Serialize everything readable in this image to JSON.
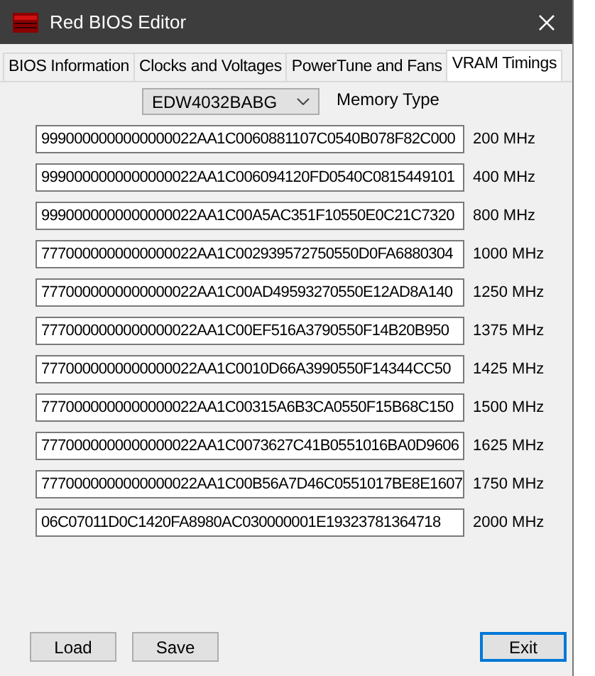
{
  "window": {
    "title": "Red BIOS Editor"
  },
  "tabs": [
    {
      "label": "BIOS Information",
      "selected": false
    },
    {
      "label": "Clocks and Voltages",
      "selected": false
    },
    {
      "label": "PowerTune and Fans",
      "selected": false
    },
    {
      "label": "VRAM Timings",
      "selected": true
    }
  ],
  "memory_type": {
    "value": "EDW4032BABG",
    "label": "Memory Type"
  },
  "timings": [
    {
      "value": "9990000000000000022AA1C0060881107C0540B078F82C000",
      "frequency": "200 MHz"
    },
    {
      "value": "9990000000000000022AA1C006094120FD0540C0815449101",
      "frequency": "400 MHz"
    },
    {
      "value": "9990000000000000022AA1C00A5AC351F10550E0C21C7320",
      "frequency": "800 MHz"
    },
    {
      "value": "7770000000000000022AA1C002939572750550D0FA6880304",
      "frequency": "1000 MHz"
    },
    {
      "value": "7770000000000000022AA1C00AD49593270550E12AD8A140",
      "frequency": "1250 MHz"
    },
    {
      "value": "7770000000000000022AA1C00EF516A3790550F14B20B950",
      "frequency": "1375 MHz"
    },
    {
      "value": "7770000000000000022AA1C0010D66A3990550F14344CC50",
      "frequency": "1425 MHz"
    },
    {
      "value": "7770000000000000022AA1C00315A6B3CA0550F15B68C150",
      "frequency": "1500 MHz"
    },
    {
      "value": "7770000000000000022AA1C0073627C41B0551016BA0D9606",
      "frequency": "1625 MHz"
    },
    {
      "value": "7770000000000000022AA1C00B56A7D46C0551017BE8E1607",
      "frequency": "1750 MHz"
    },
    {
      "value": "06C07011D0C1420FA8980AC030000001E19323781364718",
      "frequency": "2000 MHz"
    }
  ],
  "buttons": [
    {
      "label": "Load",
      "focused": false
    },
    {
      "label": "Save",
      "focused": false
    },
    {
      "label": "Exit",
      "focused": true
    }
  ]
}
